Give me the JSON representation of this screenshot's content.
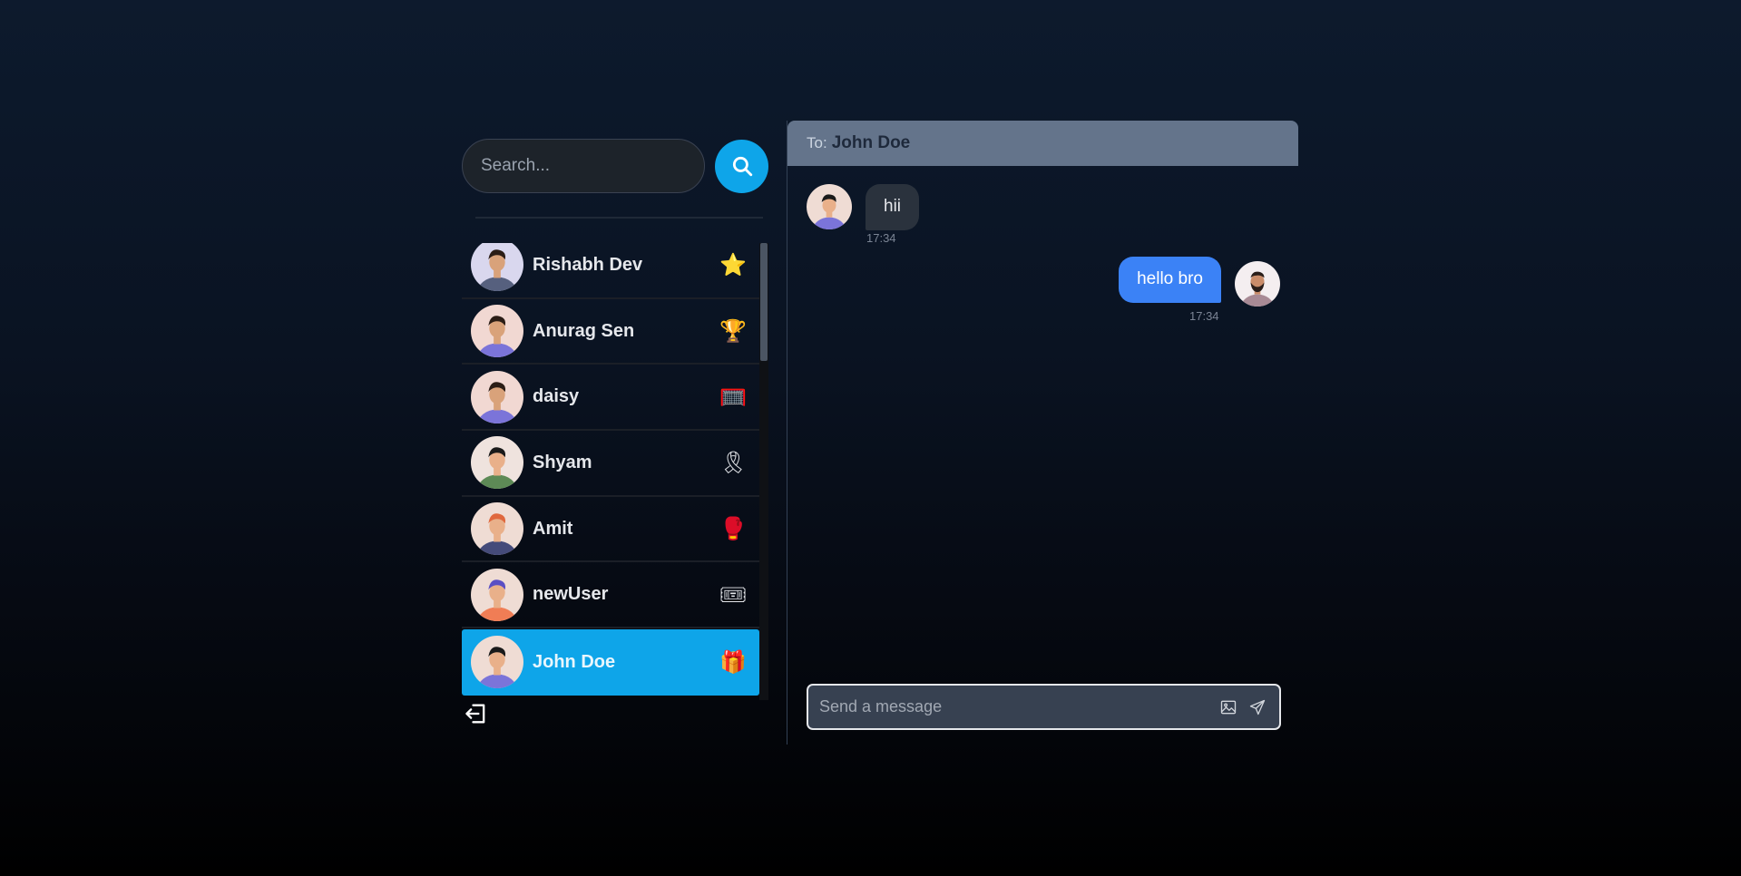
{
  "search": {
    "placeholder": "Search..."
  },
  "conversations": [
    {
      "name": "Rishabh Dev",
      "emoji": "⭐",
      "skin": "#d9a27a",
      "shirt": "#56607e",
      "hair": "#2b1d16",
      "bg": "#d9d7ee"
    },
    {
      "name": "Anurag Sen",
      "emoji": "🏆",
      "skin": "#d9a27a",
      "shirt": "#7b74d9",
      "hair": "#2b1d16",
      "bg": "#f1d8d2"
    },
    {
      "name": "daisy",
      "emoji": "🥅",
      "skin": "#d9a27a",
      "shirt": "#7b74d9",
      "hair": "#2b1d16",
      "bg": "#f1d8d2"
    },
    {
      "name": "Shyam",
      "emoji": "🎗",
      "skin": "#e9b08a",
      "shirt": "#5d8a56",
      "hair": "#1a1a1a",
      "bg": "#efe3de"
    },
    {
      "name": "Amit",
      "emoji": "🥊",
      "skin": "#e9b08a",
      "shirt": "#454b7a",
      "hair": "#e0683e",
      "bg": "#efdcd4"
    },
    {
      "name": "newUser",
      "emoji": "🎟",
      "skin": "#e9b08a",
      "shirt": "#f07d55",
      "hair": "#5b4fc4",
      "bg": "#efdcd4"
    },
    {
      "name": "John Doe",
      "emoji": "🎁",
      "skin": "#e9b08a",
      "shirt": "#7b74d9",
      "hair": "#1a1a1a",
      "bg": "#efdcd4",
      "selected": true
    }
  ],
  "chat": {
    "to_label": "To:",
    "to_name": "John Doe",
    "messages": [
      {
        "text": "hii",
        "time": "17:34",
        "direction": "in"
      },
      {
        "text": "hello bro",
        "time": "17:34",
        "direction": "out"
      }
    ],
    "input_placeholder": "Send a message"
  },
  "icons": {
    "search": "search-icon",
    "logout": "logout-icon",
    "image": "image-icon",
    "send": "send-icon"
  },
  "colors": {
    "accent": "#0ea5e9",
    "outgoing_bubble": "#3b82f6",
    "incoming_bubble": "#2a323d",
    "header": "#64748b"
  }
}
